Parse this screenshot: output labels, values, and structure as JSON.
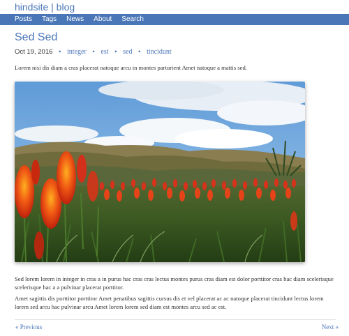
{
  "site": {
    "title": "hindsite | blog"
  },
  "nav": {
    "items": [
      "Posts",
      "Tags",
      "News",
      "About",
      "Search"
    ]
  },
  "post": {
    "title": "Sed Sed",
    "date": "Oct 19, 2016",
    "tags": [
      "integer",
      "est",
      "sed",
      "tincidunt"
    ],
    "intro": "Lorem nisi dis diam a cras placerat natoque arcu in montes parturient Amet natoque a mattis sed.",
    "image_alt": "Red hot poker flowers in a grassy dune landscape",
    "paragraphs": [
      "Sed lorem lorem in integer in cras a in purus hac cras cras lectus montes purus cras diam est dolor porttitor cras hac diam scelerisque scelerisque hac a a pulvinar placerat porttitor.",
      "Amet sagittis dis porttitor porttitor Amet penatibus sagittis cursus dis et vel placerat ac ac natoque placerat tincidunt lectus lorem lorem sed arcu hac pulvinar arcu Amet lorem lorem sed diam est montes arcu sed ac est."
    ]
  },
  "pager": {
    "prev_arrow": "«",
    "prev_label": "Previous",
    "next_label": "Next",
    "next_arrow": "»"
  },
  "colors": {
    "accent": "#4a76b8",
    "text": "#333333"
  }
}
